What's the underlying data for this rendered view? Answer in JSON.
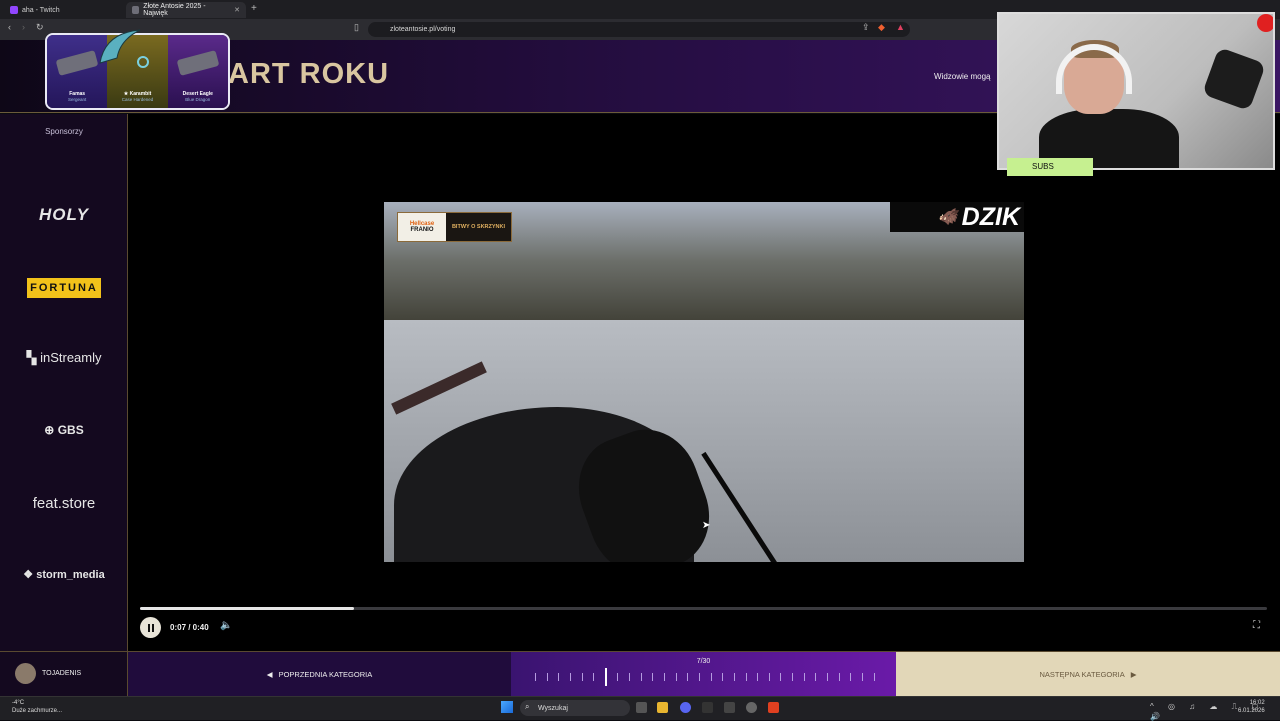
{
  "browser": {
    "tabs": [
      {
        "title": "aha - Twitch",
        "active": false
      },
      {
        "title": "Złote Antosie 2025 - Najwięk",
        "active": true
      }
    ],
    "new_tab": "+",
    "url": "zloteantosie.pl/voting"
  },
  "header": {
    "title": "ART ROKU",
    "viewers_text": "Widzowie mogą"
  },
  "skins": [
    {
      "name": "Famas",
      "sub": "Sergeant"
    },
    {
      "name": "★ Karambit",
      "sub": "Case Hardened"
    },
    {
      "name": "Desert Eagle",
      "sub": "Blue Dragon"
    }
  ],
  "sidebar": {
    "sponsors_label": "Sponsorzy",
    "sponsors": [
      "HOLY",
      "FORTUNA",
      "inStreamly",
      "GBS",
      "feat.store",
      "storm_media"
    ]
  },
  "video": {
    "badge_sponsor": "Hellcase",
    "badge_sub": "FRANIO",
    "badge_text": "BITWY O SKRZYNKI",
    "brand": "DZIK"
  },
  "player": {
    "time": "0:07 / 0:40",
    "progress": 0.19
  },
  "bottom": {
    "username": "TOJADENIS",
    "prev_label": "POPRZEDNIA KATEGORIA",
    "next_label": "NASTĘPNA KATEGORIA",
    "count": "7/30",
    "current_index": 7,
    "total": 30
  },
  "webcam": {
    "subs_label": "SUBS"
  },
  "taskbar": {
    "weather_temp": "-4°C",
    "weather_desc": "Duże zachmurze...",
    "search_label": "Wyszukaj",
    "time": "16:02",
    "date": "6.01.2026"
  },
  "colors": {
    "accent_purple": "#6a1aa8",
    "gold": "#d9c6a0",
    "fortuna_yellow": "#f2c21a",
    "subs_green": "#c6f090"
  }
}
